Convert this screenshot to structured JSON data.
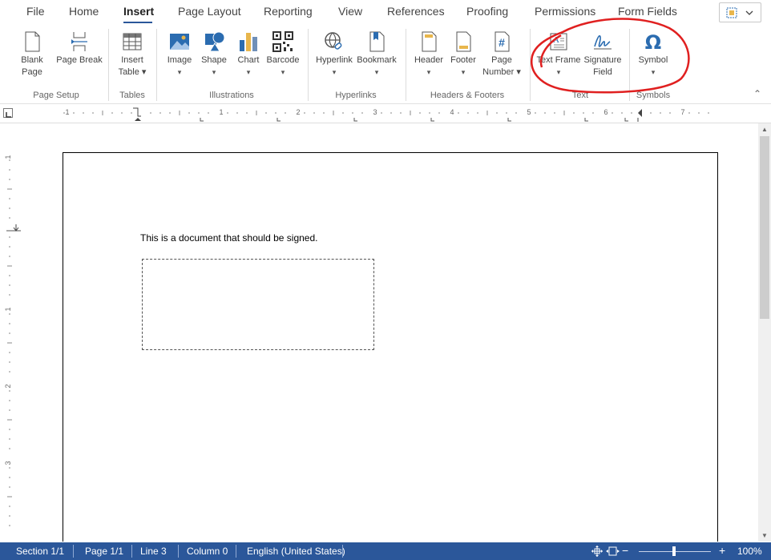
{
  "tabs": [
    "File",
    "Home",
    "Insert",
    "Page Layout",
    "Reporting",
    "View",
    "References",
    "Proofing",
    "Permissions",
    "Form Fields"
  ],
  "active_tab": "Insert",
  "ribbon": {
    "groups": {
      "page_setup": "Page Setup",
      "tables": "Tables",
      "illustrations": "Illustrations",
      "hyperlinks": "Hyperlinks",
      "headers_footers": "Headers & Footers",
      "text": "Text",
      "symbols": "Symbols"
    },
    "buttons": {
      "blank_page": "Blank Page",
      "page_break": "Page Break",
      "insert_table_1": "Insert",
      "insert_table_2": "Table ▾",
      "image": "Image",
      "shape": "Shape",
      "chart": "Chart",
      "barcode": "Barcode",
      "hyperlink": "Hyperlink",
      "bookmark": "Bookmark",
      "header": "Header",
      "footer": "Footer",
      "page_number_1": "Page",
      "page_number_2": "Number ▾",
      "text_frame": "Text Frame",
      "signature_field_1": "Signature",
      "signature_field_2": "Field",
      "symbol": "Symbol"
    },
    "dropdown_glyph": "▾",
    "collapse_glyph": "⌃"
  },
  "ruler_numbers": [
    "1",
    "1",
    "2",
    "3",
    "4",
    "5",
    "6",
    "7"
  ],
  "vruler_numbers": [
    "1",
    "1",
    "2",
    "3"
  ],
  "document": {
    "text": "This is a document that should be signed."
  },
  "status": {
    "section": "Section 1/1",
    "page": "Page 1/1",
    "line": "Line 3",
    "column": "Column 0",
    "language": "English (United States)",
    "zoom_minus": "−",
    "zoom_plus": "+",
    "zoom": "100%"
  },
  "colors": {
    "accent": "#2b579a",
    "annotation": "#e02020",
    "icon_blue": "#2b6cb0",
    "icon_yellow": "#e8b64c"
  }
}
